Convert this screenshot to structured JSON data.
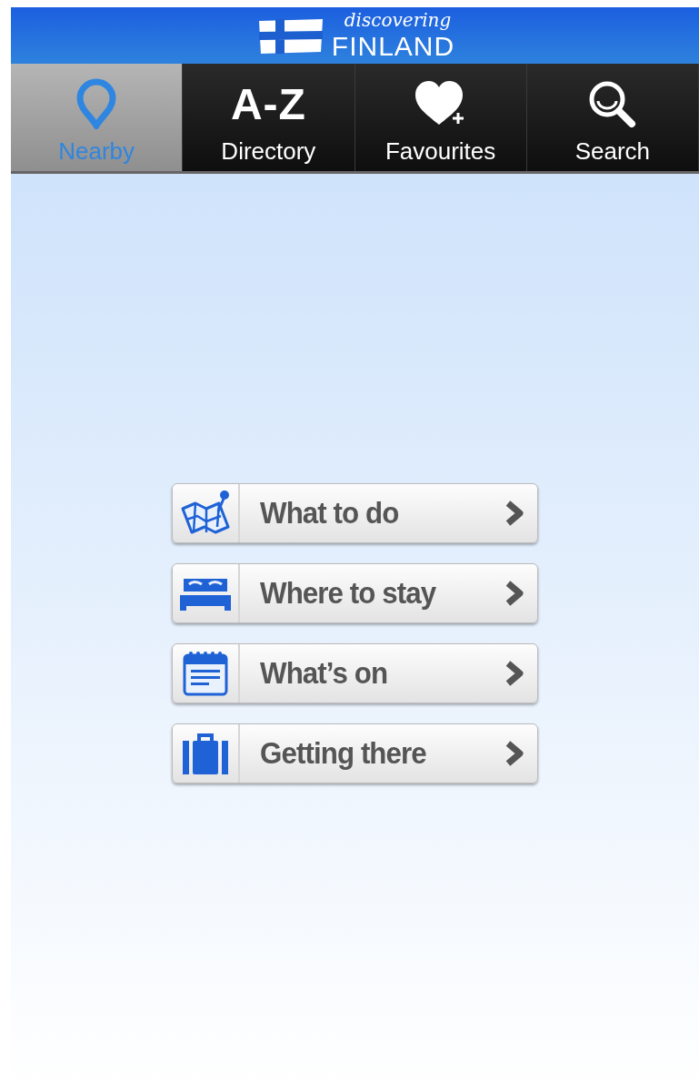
{
  "header": {
    "logo_small": "discovering",
    "logo_large": "FINLAND"
  },
  "tabs": [
    {
      "kind": "pin",
      "label": "Nearby",
      "selected": true
    },
    {
      "kind": "glyph",
      "glyph": "A-Z",
      "label": "Directory",
      "selected": false
    },
    {
      "kind": "heart",
      "label": "Favourites",
      "selected": false
    },
    {
      "kind": "search",
      "label": "Search",
      "selected": false
    }
  ],
  "menu": [
    {
      "kind": "map",
      "label": "What to do"
    },
    {
      "kind": "bed",
      "label": "Where to stay"
    },
    {
      "kind": "calendar",
      "label": "What’s on"
    },
    {
      "kind": "suitcase",
      "label": "Getting there"
    }
  ]
}
